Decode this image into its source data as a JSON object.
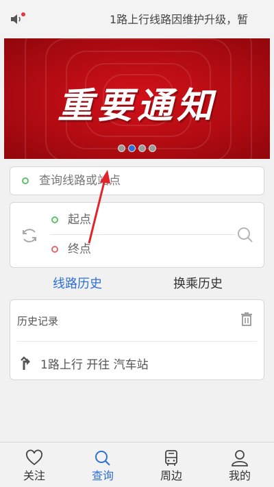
{
  "notice": {
    "text": "1路上行线路因维护升级，暂",
    "icon": "speaker-icon",
    "badge_color": "#e23a3a"
  },
  "banner": {
    "title": "重要通知",
    "slide_count": 4,
    "active_slide": 1,
    "accent_color": "#c40e16"
  },
  "search": {
    "placeholder": "查询线路或站点"
  },
  "route": {
    "start_placeholder": "起点",
    "end_placeholder": "终点",
    "swap_icon": "swap-icon",
    "search_icon": "search-icon"
  },
  "tabs": [
    {
      "label": "线路历史",
      "active": true
    },
    {
      "label": "换乘历史",
      "active": false
    }
  ],
  "history": {
    "title": "历史记录",
    "delete_icon": "trash-icon",
    "items": [
      {
        "text": "1路上行 开往 汽车站",
        "icon": "route-turn-icon"
      }
    ]
  },
  "bottom_nav": [
    {
      "label": "关注",
      "icon": "heart-icon",
      "active": false
    },
    {
      "label": "查询",
      "icon": "search-icon",
      "active": true
    },
    {
      "label": "周边",
      "icon": "bus-icon",
      "active": false
    },
    {
      "label": "我的",
      "icon": "user-icon",
      "active": false
    }
  ],
  "colors": {
    "accent": "#2f6fd6",
    "start_marker": "#5cc269",
    "end_marker": "#e06a6a",
    "annotation_arrow": "#e0242a"
  }
}
